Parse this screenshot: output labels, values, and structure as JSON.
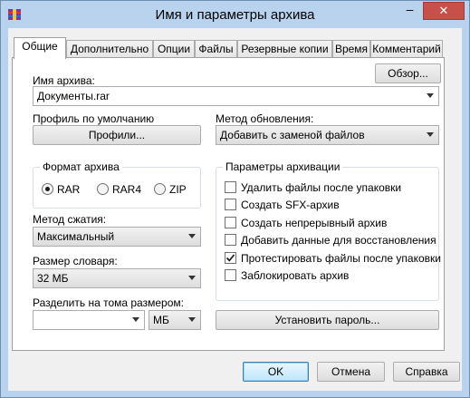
{
  "window": {
    "title": "Имя и параметры архива",
    "minimize": "–",
    "close": "✕"
  },
  "tabs": [
    {
      "label": "Общие",
      "active": true
    },
    {
      "label": "Дополнительно"
    },
    {
      "label": "Опции"
    },
    {
      "label": "Файлы"
    },
    {
      "label": "Резервные копии"
    },
    {
      "label": "Время"
    },
    {
      "label": "Комментарий"
    }
  ],
  "archive_name": {
    "label": "Имя архива:",
    "value": "Документы.rar",
    "browse": "Обзор..."
  },
  "profile": {
    "label": "Профиль по умолчанию",
    "button": "Профили..."
  },
  "update_method": {
    "label": "Метод обновления:",
    "value": "Добавить с заменой файлов"
  },
  "format": {
    "label": "Формат архива",
    "options": [
      {
        "label": "RAR",
        "checked": true
      },
      {
        "label": "RAR4",
        "checked": false
      },
      {
        "label": "ZIP",
        "checked": false
      }
    ]
  },
  "compression": {
    "label": "Метод сжатия:",
    "value": "Максимальный"
  },
  "dictionary": {
    "label": "Размер словаря:",
    "value": "32 МБ"
  },
  "split": {
    "label": "Разделить на тома размером:",
    "value": "",
    "unit": "МБ"
  },
  "options": {
    "label": "Параметры архивации",
    "items": [
      {
        "label": "Удалить файлы после упаковки",
        "checked": false
      },
      {
        "label": "Создать SFX-архив",
        "checked": false
      },
      {
        "label": "Создать непрерывный архив",
        "checked": false
      },
      {
        "label": "Добавить данные для восстановления",
        "checked": false
      },
      {
        "label": "Протестировать файлы после упаковки",
        "checked": true
      },
      {
        "label": "Заблокировать архив",
        "checked": false
      }
    ]
  },
  "password_button": "Установить пароль...",
  "footer": {
    "ok": "OK",
    "cancel": "Отмена",
    "help": "Справка"
  },
  "colors": {
    "title_bg": "#b9d3ee",
    "close_bg": "#c7504a",
    "panel_bg": "#ffffff",
    "dialog_bg": "#f0f0f0"
  }
}
